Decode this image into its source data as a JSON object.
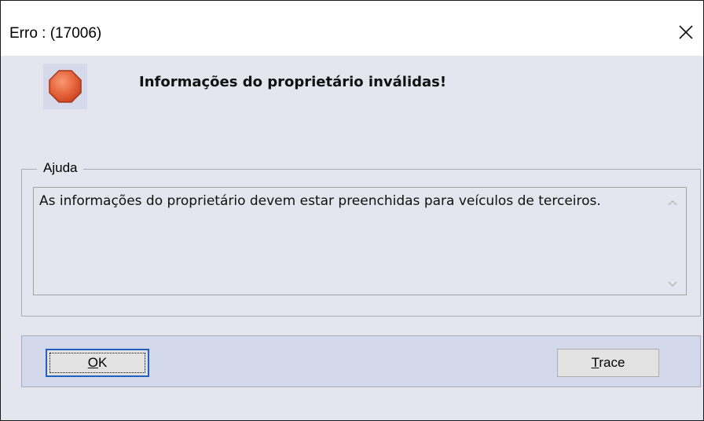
{
  "window": {
    "title": "Erro : (17006)"
  },
  "message": {
    "text": "Informações do proprietário inválidas!",
    "icon": "stop-octagon-icon"
  },
  "help": {
    "legend": "Ajuda",
    "text": "As informações do proprietário devem estar preenchidas para veículos de terceiros."
  },
  "buttons": {
    "ok_mnemonic": "O",
    "ok_rest": "K",
    "trace_mnemonic": "T",
    "trace_rest": "race"
  },
  "colors": {
    "stop_icon_fill": "#e8663f",
    "stop_icon_border": "#b23a1c",
    "focus_border": "#1f5fbf"
  }
}
